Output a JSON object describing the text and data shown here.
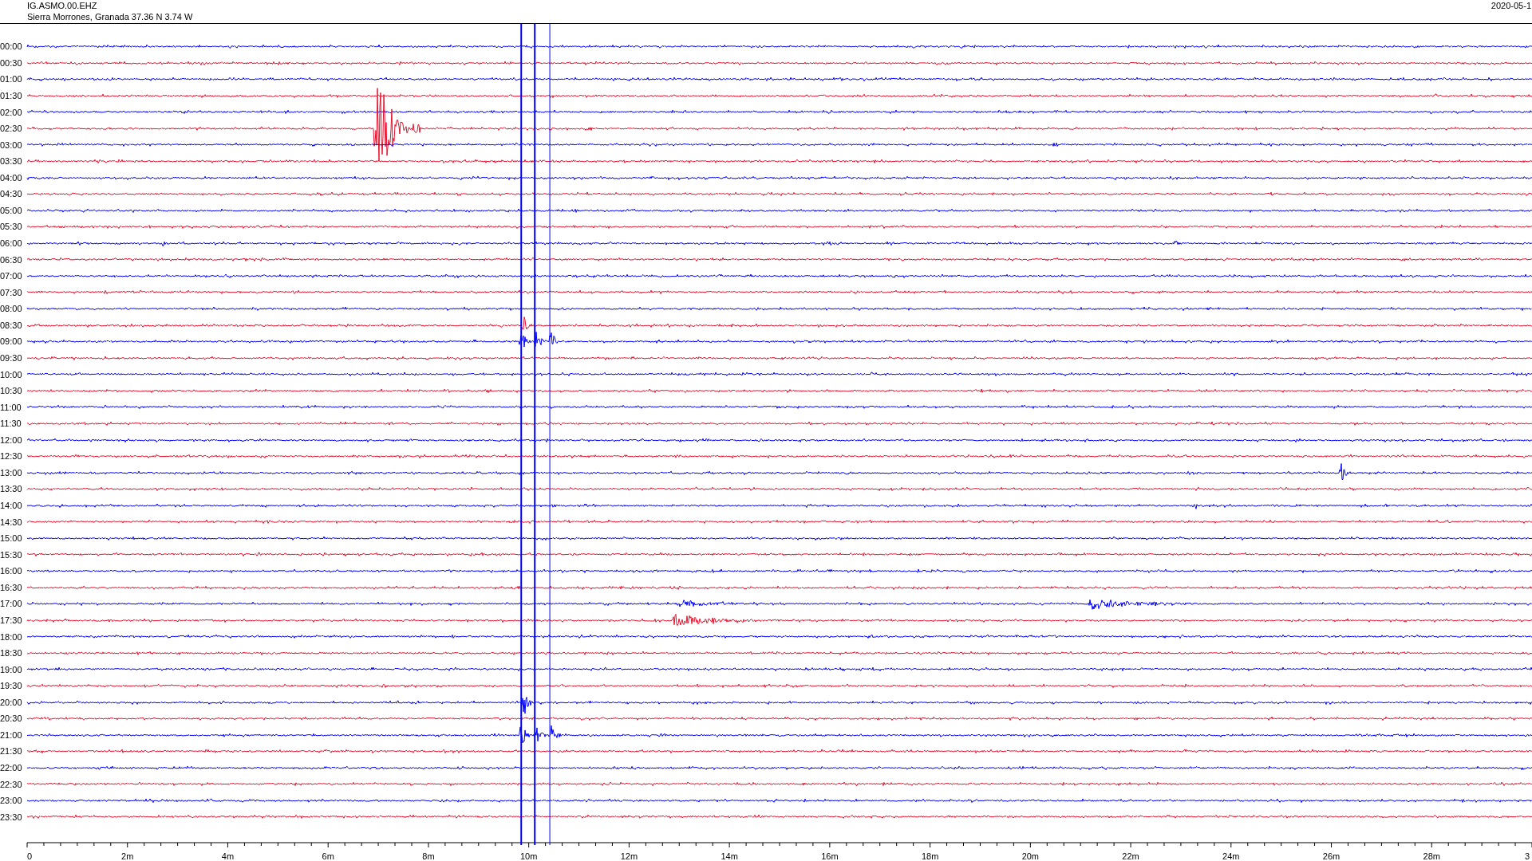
{
  "header": {
    "station": "IG.ASMO.00.EHZ",
    "location": "Sierra Morrones, Granada  37.36 N 3.74 W",
    "date": "2020-05-1"
  },
  "rows": [
    {
      "label": "00:00",
      "color": "#0000ff"
    },
    {
      "label": "00:30",
      "color": "#e8112d"
    },
    {
      "label": "01:00",
      "color": "#0000ff"
    },
    {
      "label": "01:30",
      "color": "#e8112d"
    },
    {
      "label": "02:00",
      "color": "#0000ff"
    },
    {
      "label": "02:30",
      "color": "#e8112d"
    },
    {
      "label": "03:00",
      "color": "#0000ff"
    },
    {
      "label": "03:30",
      "color": "#e8112d"
    },
    {
      "label": "04:00",
      "color": "#0000ff"
    },
    {
      "label": "04:30",
      "color": "#e8112d"
    },
    {
      "label": "05:00",
      "color": "#0000ff"
    },
    {
      "label": "05:30",
      "color": "#e8112d"
    },
    {
      "label": "06:00",
      "color": "#0000ff"
    },
    {
      "label": "06:30",
      "color": "#e8112d"
    },
    {
      "label": "07:00",
      "color": "#0000ff"
    },
    {
      "label": "07:30",
      "color": "#e8112d"
    },
    {
      "label": "08:00",
      "color": "#0000ff"
    },
    {
      "label": "08:30",
      "color": "#e8112d"
    },
    {
      "label": "09:00",
      "color": "#0000ff"
    },
    {
      "label": "09:30",
      "color": "#e8112d"
    },
    {
      "label": "10:00",
      "color": "#0000ff"
    },
    {
      "label": "10:30",
      "color": "#e8112d"
    },
    {
      "label": "11:00",
      "color": "#0000ff"
    },
    {
      "label": "11:30",
      "color": "#e8112d"
    },
    {
      "label": "12:00",
      "color": "#0000ff"
    },
    {
      "label": "12:30",
      "color": "#e8112d"
    },
    {
      "label": "13:00",
      "color": "#0000ff"
    },
    {
      "label": "13:30",
      "color": "#e8112d"
    },
    {
      "label": "14:00",
      "color": "#0000ff"
    },
    {
      "label": "14:30",
      "color": "#e8112d"
    },
    {
      "label": "15:00",
      "color": "#0000ff"
    },
    {
      "label": "15:30",
      "color": "#e8112d"
    },
    {
      "label": "16:00",
      "color": "#0000ff"
    },
    {
      "label": "16:30",
      "color": "#e8112d"
    },
    {
      "label": "17:00",
      "color": "#0000ff"
    },
    {
      "label": "17:30",
      "color": "#e8112d"
    },
    {
      "label": "18:00",
      "color": "#0000ff"
    },
    {
      "label": "18:30",
      "color": "#e8112d"
    },
    {
      "label": "19:00",
      "color": "#0000ff"
    },
    {
      "label": "19:30",
      "color": "#e8112d"
    },
    {
      "label": "20:00",
      "color": "#0000ff"
    },
    {
      "label": "20:30",
      "color": "#e8112d"
    },
    {
      "label": "21:00",
      "color": "#0000ff"
    },
    {
      "label": "21:30",
      "color": "#e8112d"
    },
    {
      "label": "22:00",
      "color": "#0000ff"
    },
    {
      "label": "22:30",
      "color": "#e8112d"
    },
    {
      "label": "23:00",
      "color": "#0000ff"
    },
    {
      "label": "23:30",
      "color": "#e8112d"
    }
  ],
  "time_axis": {
    "labels": [
      "0",
      "2m",
      "4m",
      "6m",
      "8m",
      "10m",
      "12m",
      "14m",
      "16m",
      "18m",
      "20m",
      "22m",
      "24m",
      "26m",
      "28m",
      "3"
    ]
  }
}
